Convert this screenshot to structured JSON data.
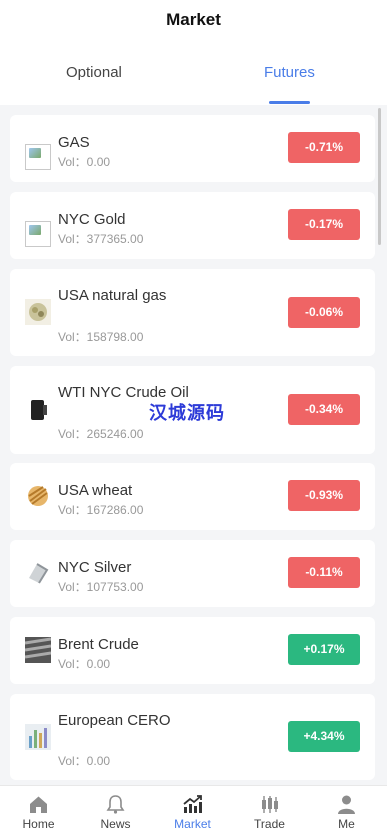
{
  "header": {
    "title": "Market"
  },
  "tabs": [
    {
      "label": "Optional"
    },
    {
      "label": "Futures"
    }
  ],
  "items": [
    {
      "name": "GAS",
      "vol": "Vol：0.00",
      "change": "-0.71%",
      "direction": "down"
    },
    {
      "name": "NYC Gold",
      "vol": "Vol：377365.00",
      "change": "-0.17%",
      "direction": "down"
    },
    {
      "name": "USA natural gas",
      "vol": "Vol：158798.00",
      "change": "-0.06%",
      "direction": "down"
    },
    {
      "name": "WTI NYC Crude Oil",
      "vol": "Vol：265246.00",
      "change": "-0.34%",
      "direction": "down"
    },
    {
      "name": "USA wheat",
      "vol": "Vol：167286.00",
      "change": "-0.93%",
      "direction": "down"
    },
    {
      "name": "NYC Silver",
      "vol": "Vol：107753.00",
      "change": "-0.11%",
      "direction": "down"
    },
    {
      "name": "Brent Crude",
      "vol": "Vol：0.00",
      "change": "+0.17%",
      "direction": "up"
    },
    {
      "name": "European CERO",
      "vol": "Vol：0.00",
      "change": "+4.34%",
      "direction": "up"
    }
  ],
  "watermark": "汉城源码",
  "nav": [
    {
      "label": "Home",
      "icon": "home-icon"
    },
    {
      "label": "News",
      "icon": "bell-icon"
    },
    {
      "label": "Market",
      "icon": "chart-icon",
      "active": true
    },
    {
      "label": "Trade",
      "icon": "candlestick-icon"
    },
    {
      "label": "Me",
      "icon": "person-icon"
    }
  ],
  "colors": {
    "accent": "#4a7de8",
    "down": "#ef6465",
    "up": "#2bb880"
  }
}
